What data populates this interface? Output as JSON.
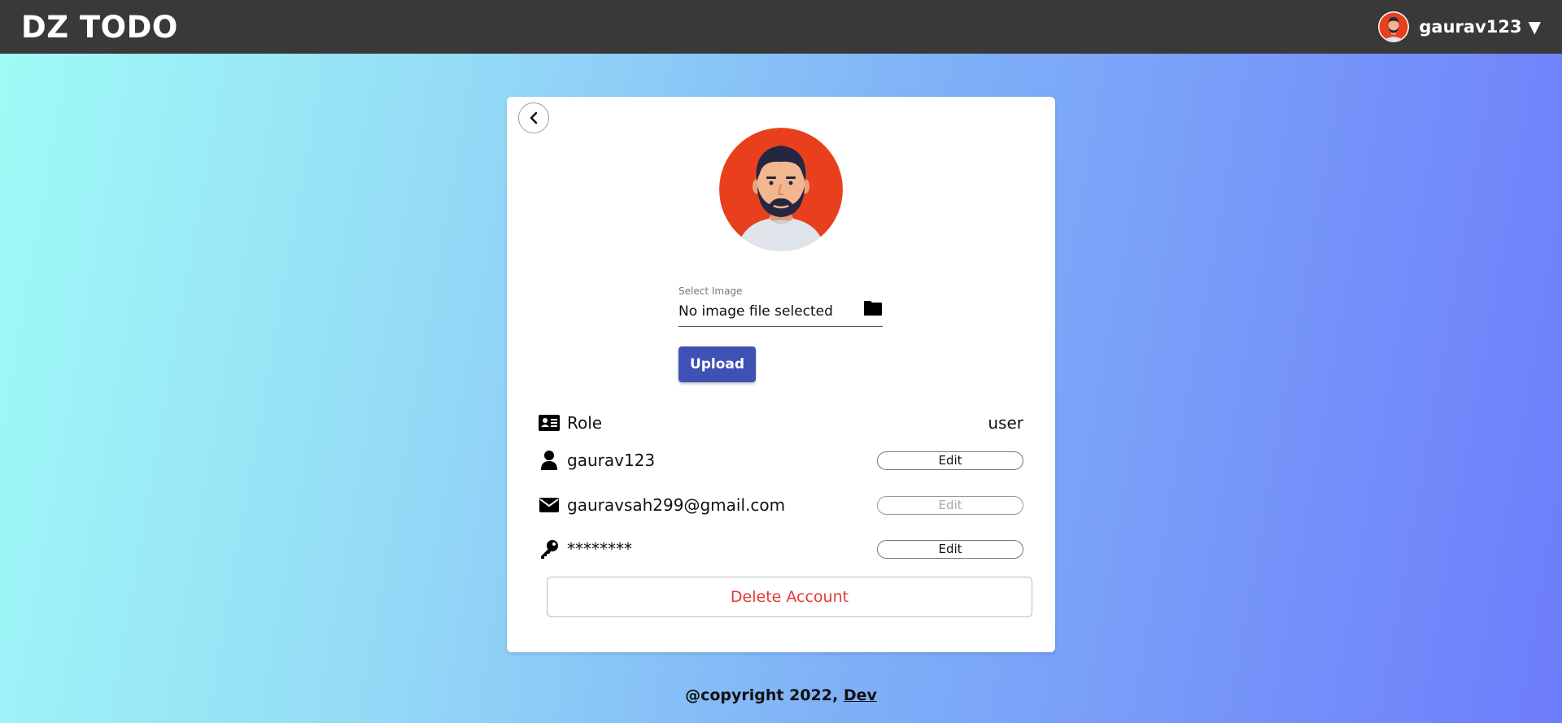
{
  "navbar": {
    "brand": "DZ TODO",
    "username": "gaurav123",
    "caret": "▼"
  },
  "profile": {
    "file_field": {
      "label": "Select Image",
      "value": "No image file selected"
    },
    "upload_label": "Upload",
    "role": {
      "label": "Role",
      "value": "user"
    },
    "username": {
      "value": "gaurav123",
      "edit_label": "Edit"
    },
    "email": {
      "value": "gauravsah299@gmail.com",
      "edit_label": "Edit"
    },
    "password": {
      "value": "********",
      "edit_label": "Edit"
    },
    "delete_label": "Delete Account"
  },
  "footer": {
    "text": "@copyright 2022, ",
    "link": "Dev"
  },
  "icons": {
    "back": "chevron-left-icon",
    "folder": "folder-icon",
    "role": "id-card-icon",
    "user": "user-icon",
    "email": "envelope-icon",
    "password": "key-icon"
  },
  "colors": {
    "navbar_bg": "#393939",
    "upload_bg": "#3f51b5",
    "delete_text": "#e53935",
    "avatar_bg": "#e8401c"
  }
}
